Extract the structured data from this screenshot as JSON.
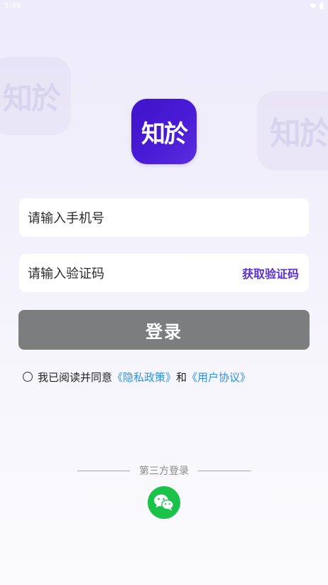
{
  "status_bar": {
    "time": "5:46"
  },
  "logo": {
    "text": "知於",
    "ghost_text": "知於"
  },
  "phone_field": {
    "placeholder": "请输入手机号"
  },
  "code_field": {
    "placeholder": "请输入验证码",
    "get_code_label": "获取验证码"
  },
  "login_button": {
    "label": "登录"
  },
  "agreement": {
    "prefix": "我已阅读并同意",
    "privacy_link": "《隐私政策》",
    "conjunction": "和",
    "user_agreement_link": "《用户协议》"
  },
  "third_party": {
    "label": "第三方登录"
  },
  "colors": {
    "accent": "#5b2fd6",
    "logo_bg": "#4a1bd6",
    "login_button_bg": "#7c7d7e",
    "link": "#2f8fe8",
    "wechat": "#1bc24a"
  },
  "icons": {
    "wifi": "wifi-icon",
    "battery": "battery-icon",
    "wechat": "wechat-icon",
    "radio": "radio-unchecked-icon"
  }
}
